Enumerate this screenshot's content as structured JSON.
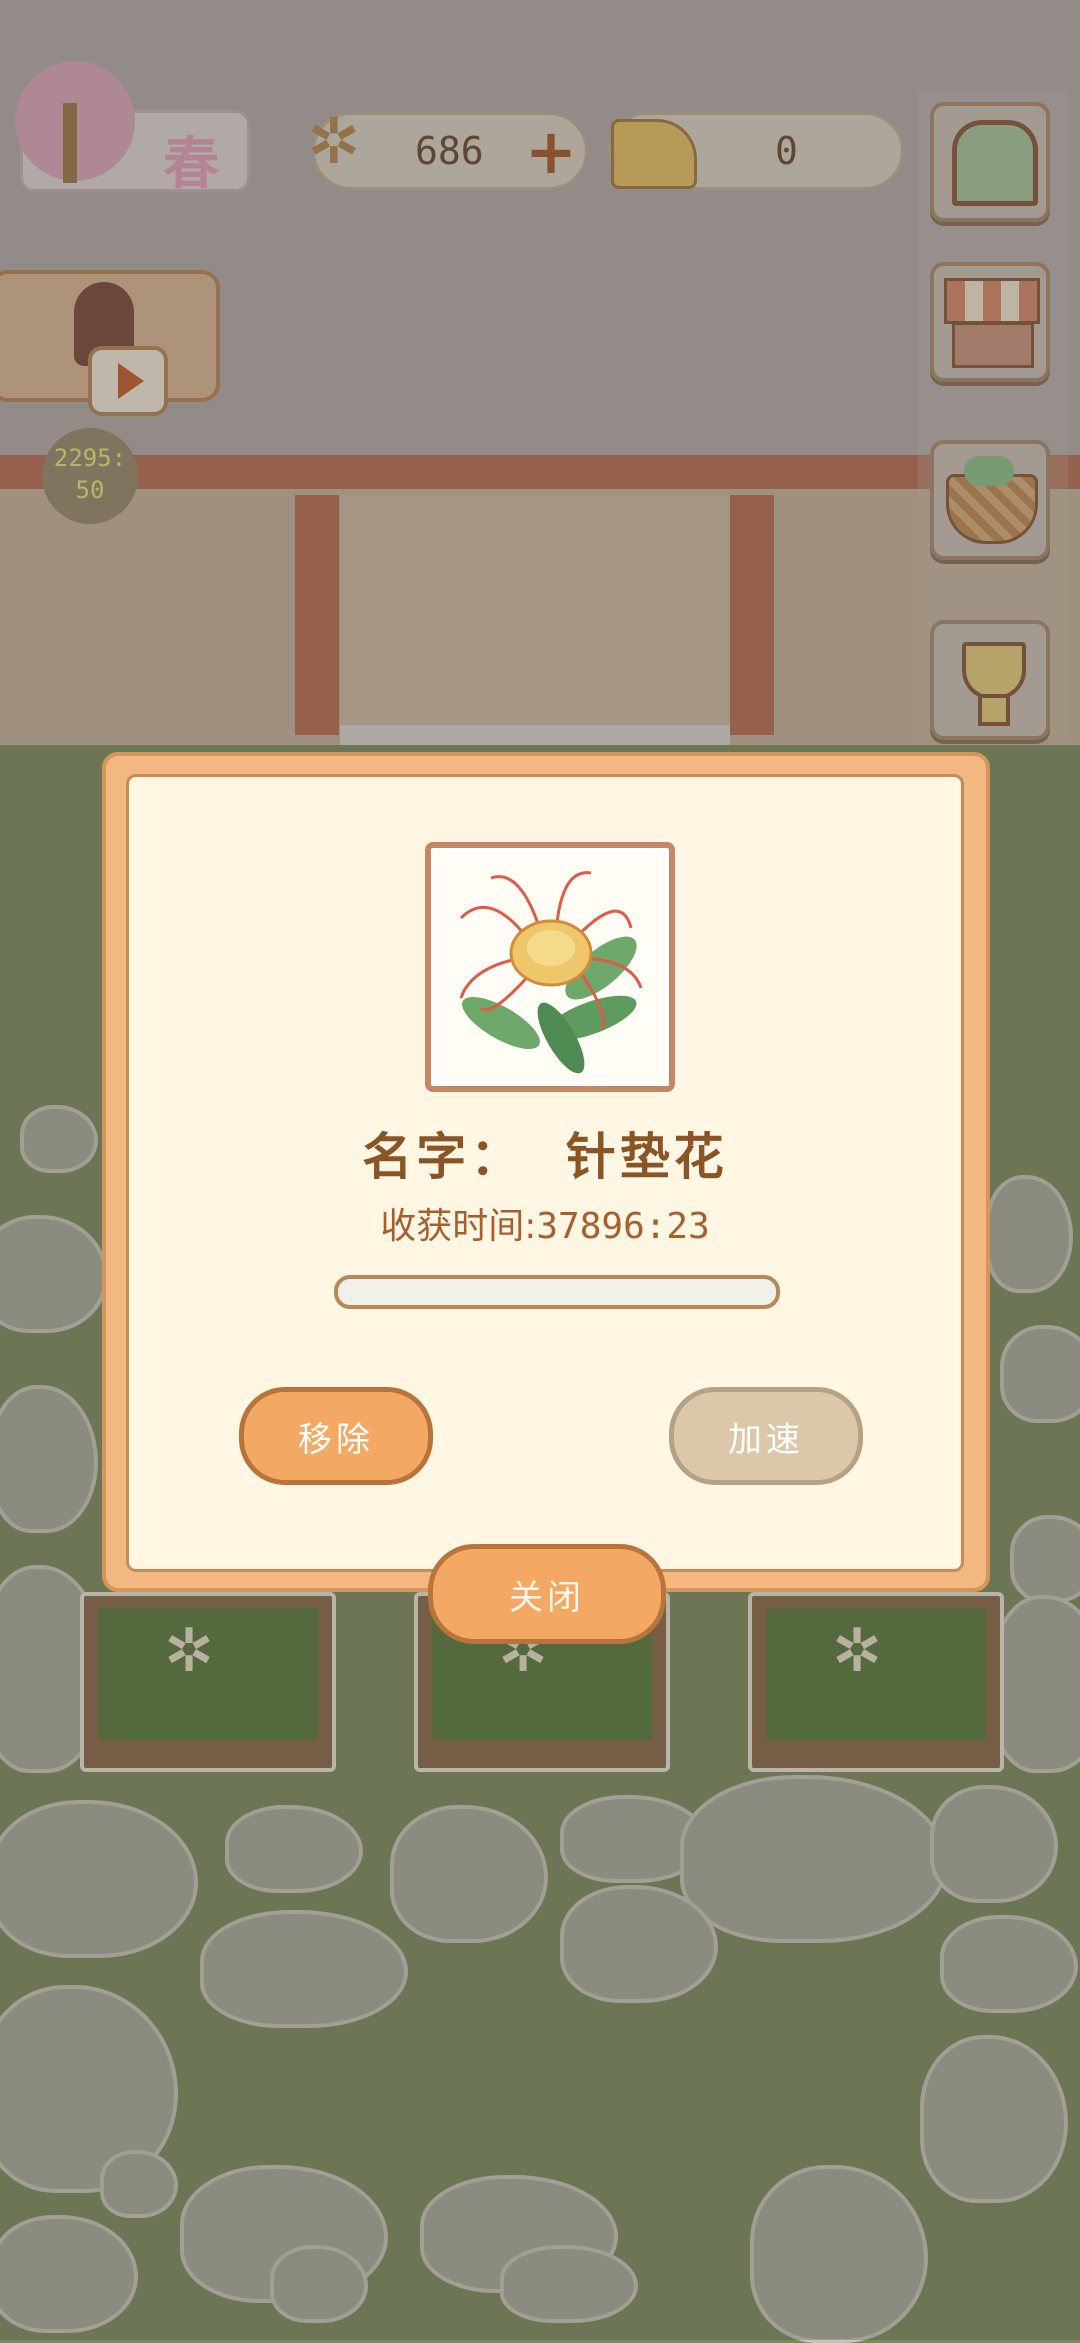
{
  "season": {
    "label": "春",
    "icon": "cherry-tree-icon"
  },
  "currency": {
    "fish_bones": {
      "value": "686",
      "icon": "fish-bone-icon"
    },
    "cheese": {
      "value": "0",
      "icon": "cheese-icon"
    }
  },
  "video_ad": {
    "icon": "play-icon"
  },
  "timer_badge": {
    "line1": "2295:",
    "line2": "50"
  },
  "side_menu": [
    {
      "id": "window",
      "icon": "window-icon"
    },
    {
      "id": "shop",
      "icon": "shop-stall-icon"
    },
    {
      "id": "basket",
      "icon": "flower-basket-icon"
    },
    {
      "id": "trophy",
      "icon": "trophy-icon"
    }
  ],
  "dialog": {
    "name_label": "名字：",
    "plant_name": "针垫花",
    "time_label": "收获时间:",
    "time_value": "37896:23",
    "progress": 0.0,
    "remove_button": "移除",
    "speed_button": "加速",
    "close_button": "关闭"
  },
  "colors": {
    "accent": "#f3a863",
    "dialog_bg": "#fff7e4",
    "text_brown": "#8a5526"
  }
}
